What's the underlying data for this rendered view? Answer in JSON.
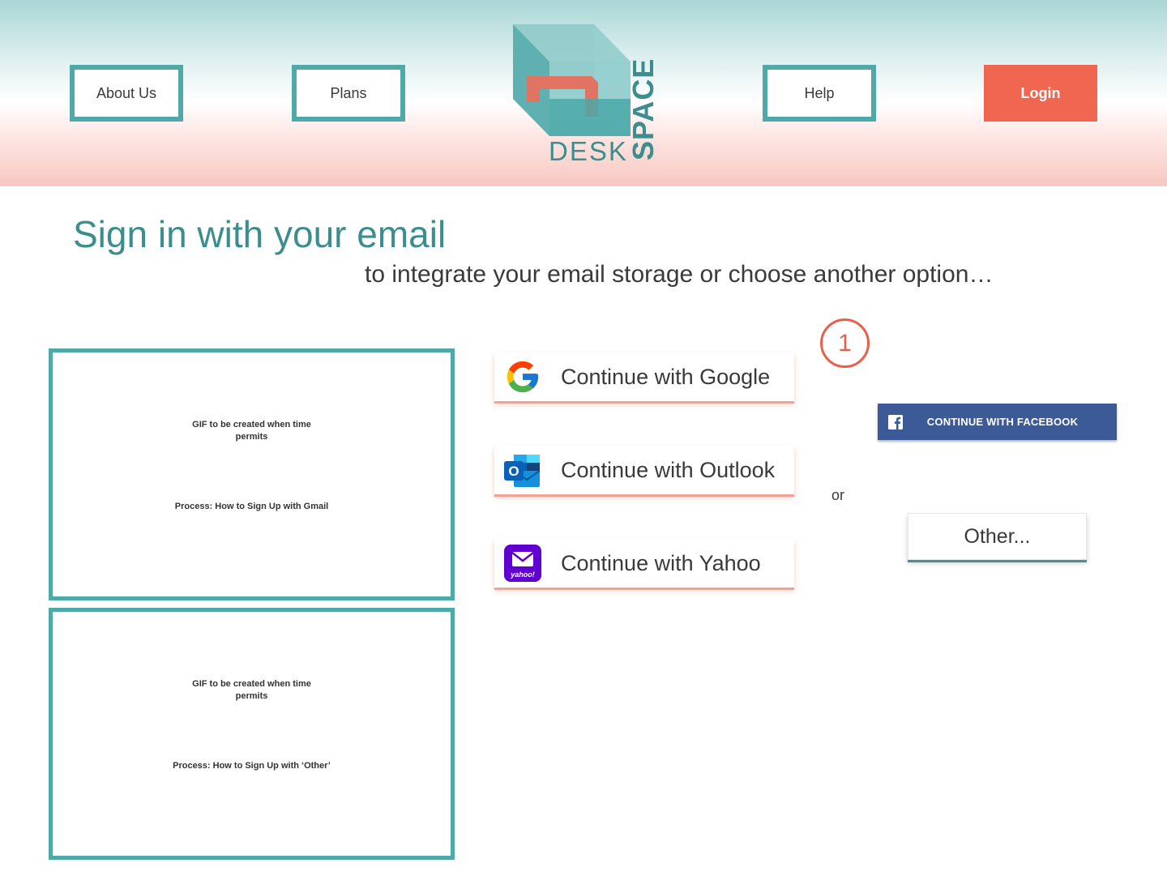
{
  "nav": {
    "about": "About Us",
    "plans": "Plans",
    "help": "Help",
    "login": "Login"
  },
  "logo": {
    "word1": "DESK",
    "word2": "SPACE"
  },
  "colors": {
    "teal": "#4fa9a9",
    "coral": "#f06650",
    "facebook": "#3d5a98"
  },
  "main": {
    "title": "Sign in with your email",
    "subtitle": "to integrate your email storage or choose another option…"
  },
  "gif_boxes": [
    {
      "note": "GIF to be created when time permits",
      "process": "Process: How to Sign Up with Gmail"
    },
    {
      "note": "GIF to be created when time permits",
      "process": "Process: How to Sign Up with ‘Other’"
    }
  ],
  "providers": [
    {
      "label": "Continue with Google",
      "icon": "google-icon"
    },
    {
      "label": "Continue with Outlook",
      "icon": "outlook-icon"
    },
    {
      "label": "Continue with Yahoo",
      "icon": "yahoo-icon"
    }
  ],
  "step_badge": "1",
  "alt_options": {
    "facebook": "CONTINUE WITH FACEBOOK",
    "or": "or",
    "other": "Other..."
  }
}
